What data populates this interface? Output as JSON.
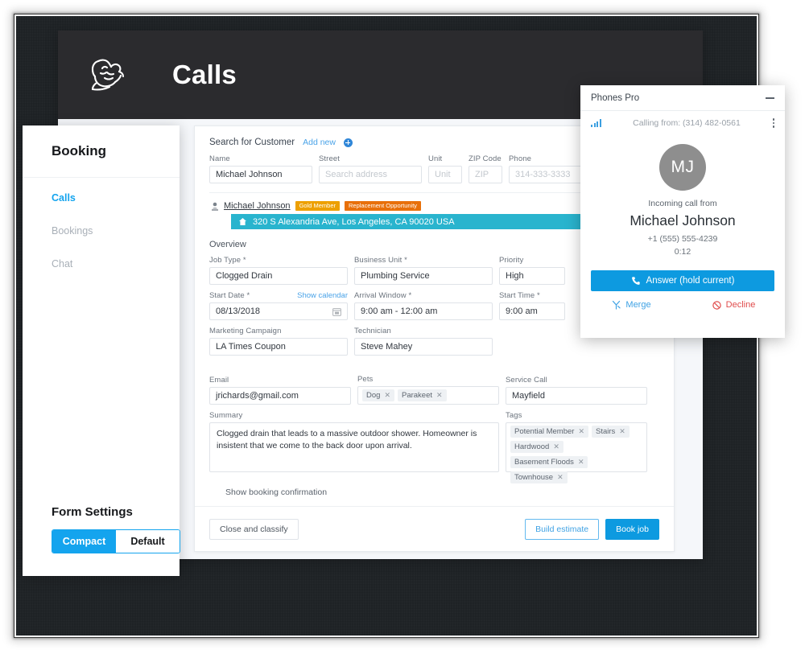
{
  "window": {
    "title": "Calls",
    "logo_icon": "plumber-logo-icon"
  },
  "left_panel": {
    "title": "Booking",
    "nav": [
      {
        "label": "Calls",
        "active": true
      },
      {
        "label": "Bookings",
        "active": false
      },
      {
        "label": "Chat",
        "active": false
      }
    ],
    "form_settings": {
      "title": "Form Settings",
      "options": [
        {
          "label": "Compact",
          "selected": true
        },
        {
          "label": "Default",
          "selected": false
        }
      ]
    }
  },
  "booking_form": {
    "search": {
      "label": "Search for Customer",
      "add_new_label": "Add new",
      "add_new_icon": "plus-circle-icon"
    },
    "fields": {
      "name": {
        "label": "Name",
        "value": "Michael Johnson"
      },
      "street": {
        "label": "Street",
        "placeholder": "Search address",
        "value": ""
      },
      "unit": {
        "label": "Unit",
        "placeholder": "Unit",
        "value": ""
      },
      "zip": {
        "label": "ZIP Code",
        "placeholder": "ZIP",
        "value": ""
      },
      "phone": {
        "label": "Phone",
        "placeholder": "314-333-3333",
        "value": ""
      }
    },
    "customer_result": {
      "person_icon": "person-icon",
      "name": "Michael Johnson",
      "badges": [
        {
          "label": "Gold Member",
          "color": "#eda003"
        },
        {
          "label": "Replacement Opportunity",
          "color": "#e8700a"
        }
      ],
      "address": {
        "home_icon": "home-icon",
        "text": "320 S Alexandria Ave, Los Angeles, CA 90020 USA",
        "highlight_color": "#29b4ce"
      }
    },
    "overview": {
      "title": "Overview",
      "job_type": {
        "label": "Job Type *",
        "value": "Clogged Drain"
      },
      "business_unit": {
        "label": "Business Unit *",
        "value": "Plumbing Service"
      },
      "priority": {
        "label": "Priority",
        "value": "High"
      },
      "start_date": {
        "label": "Start Date *",
        "value": "08/13/2018",
        "action_label": "Show calendar",
        "icon": "calendar-icon"
      },
      "arrival_window": {
        "label": "Arrival Window *",
        "value": "9:00 am - 12:00 am"
      },
      "start_time": {
        "label": "Start Time *",
        "value": "9:00 am"
      },
      "marketing_campaign": {
        "label": "Marketing Campaign",
        "value": "LA Times Coupon"
      },
      "technician": {
        "label": "Technician",
        "value": "Steve Mahey"
      }
    },
    "details": {
      "email": {
        "label": "Email",
        "value": "jrichards@gmail.com"
      },
      "pets": {
        "label": "Pets",
        "chips": [
          "Dog",
          "Parakeet"
        ]
      },
      "service_call": {
        "label": "Service Call",
        "value": "Mayfield"
      },
      "summary": {
        "label": "Summary",
        "value": "Clogged drain that leads to a massive outdoor shower. Homeowner is insistent that we come to the back door upon arrival."
      },
      "tags": {
        "label": "Tags",
        "chips": [
          "Potential Member",
          "Stairs",
          "Hardwood",
          "Basement Floods",
          "Townhouse"
        ]
      }
    },
    "show_confirmation_label": "Show booking confirmation",
    "footer": {
      "close_label": "Close and classify",
      "build_estimate_label": "Build estimate",
      "book_job_label": "Book job"
    }
  },
  "phone_widget": {
    "title": "Phones Pro",
    "minimize_icon": "minimize-icon",
    "signal_icon": "signal-bars-icon",
    "calling_from": "Calling from: (314) 482-0561",
    "menu_icon": "kebab-menu-icon",
    "avatar_initials": "MJ",
    "incoming_label": "Incoming call from",
    "caller_name": "Michael Johnson",
    "caller_number": "+1 (555) 555-4239",
    "duration": "0:12",
    "answer_label": "Answer (hold current)",
    "answer_icon": "phone-icon",
    "merge_label": "Merge",
    "merge_icon": "merge-icon",
    "decline_label": "Decline",
    "decline_icon": "decline-icon",
    "accent_color": "#0d9ae0",
    "decline_color": "#e04b4b"
  }
}
